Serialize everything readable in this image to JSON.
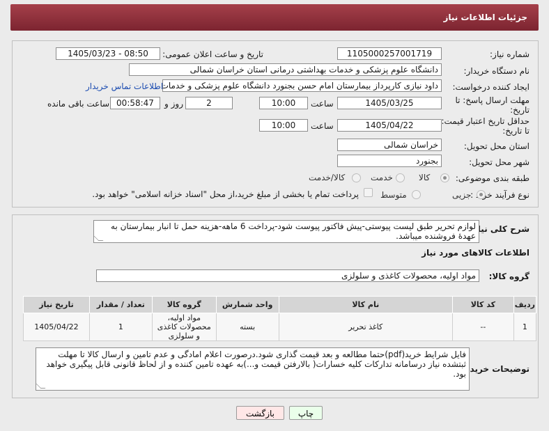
{
  "header": {
    "title": "جزئیات اطلاعات نیاز"
  },
  "form": {
    "need_number_label": "شماره نیاز:",
    "need_number": "1105000257001719",
    "announce_label": "تاریخ و ساعت اعلان عمومی:",
    "announce_value": "1405/03/23 - 08:50",
    "buyer_org_label": "نام دستگاه خریدار:",
    "buyer_org": "دانشگاه علوم پزشکی و خدمات بهداشتی درمانی استان خراسان شمالی",
    "creator_label": "ایجاد کننده درخواست:",
    "creator": "داود نیازی کارپرداز بیمارستان امام حسن بجنورد دانشگاه علوم پزشکی و خدمات",
    "contact_link": "اطلاعات تماس خریدار",
    "deadline_label_1": "مهلت ارسال پاسخ: تا",
    "deadline_label_2": "تاریخ:",
    "deadline_date": "1405/03/25",
    "time_label": "ساعت",
    "deadline_time": "10:00",
    "days_value": "2",
    "days_label": "روز و",
    "remaining_time": "00:58:47",
    "remaining_label": "ساعت باقی مانده",
    "validity_label_1": "حداقل تاریخ اعتبار قیمت:",
    "validity_label_2": "تا تاریخ:",
    "validity_date": "1405/04/22",
    "validity_time": "10:00",
    "province_label": "استان محل تحویل:",
    "province": "خراسان شمالی",
    "city_label": "شهر محل تحویل:",
    "city": "بجنورد",
    "category_label": "طبقه بندی موضوعی:",
    "category_options": [
      "کالا",
      "خدمت",
      "کالا/خدمت"
    ],
    "process_label": "نوع فرآیند خرید :",
    "process_options": [
      "جزیی",
      "متوسط"
    ],
    "payment_note": "پرداخت تمام یا بخشی از مبلغ خرید،از محل \"اسناد خزانه اسلامی\" خواهد بود."
  },
  "description": {
    "label": "شرح کلی نیاز:",
    "text": "لوازم تحریر طبق لیست پیوستی-پیش فاکتور پیوست  شود-پرداخت 6 ماهه-هزینه حمل تا انبار بیمارستان به عهدهٔ فروشنده میباشد."
  },
  "goods_info": {
    "title": "اطلاعات کالاهای مورد نیاز",
    "group_label": "گروه کالا:",
    "group_value": "مواد اولیه، محصولات کاغذی و سلولزی"
  },
  "table": {
    "headers": [
      "ردیف",
      "کد کالا",
      "نام کالا",
      "واحد شمارش",
      "گروه کالا",
      "تعداد / مقدار",
      "تاریخ نیاز"
    ],
    "rows": [
      {
        "row": "1",
        "code": "--",
        "name": "کاغذ تحریر",
        "unit": "بسته",
        "group": "مواد اولیه، محصولات کاغذی و سلولزی",
        "qty": "1",
        "date": "1405/04/22"
      }
    ]
  },
  "buyer_notes": {
    "label": "توضیحات خریدار:",
    "text": "فایل شرایط خرید(pdf)حتما مطالعه و بعد قیمت گذاری شود.درصورت اعلام امادگی و عدم تامین و ارسال کالا تا مهلت ثبتشده نیاز درسامانه تدارکات کلیه خسارات( بالارفتن قیمت و...)به عهده تامین کننده و از لحاظ قانونی قابل پیگیری خواهد بود."
  },
  "buttons": {
    "print": "چاپ",
    "back": "بازگشت"
  }
}
